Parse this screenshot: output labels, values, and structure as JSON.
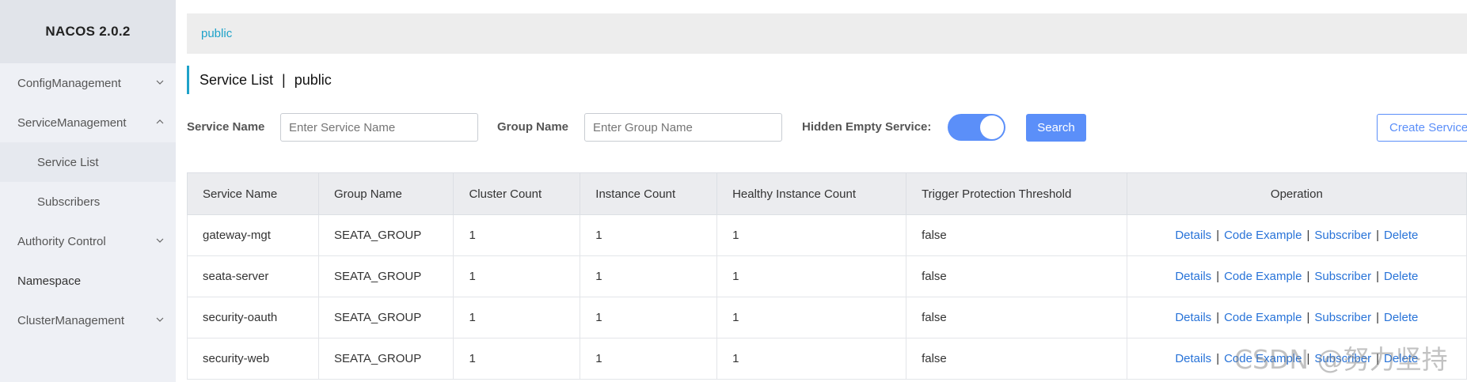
{
  "brand": {
    "title": "NACOS 2.0.2"
  },
  "sidebar": {
    "items": [
      {
        "label": "ConfigManagement"
      },
      {
        "label": "ServiceManagement"
      },
      {
        "label": "Service List"
      },
      {
        "label": "Subscribers"
      },
      {
        "label": "Authority Control"
      },
      {
        "label": "Namespace"
      },
      {
        "label": "ClusterManagement"
      }
    ]
  },
  "breadcrumb": {
    "namespace": "public"
  },
  "page": {
    "title": "Service List",
    "separator": "|",
    "namespace": "public"
  },
  "filters": {
    "service_name_label": "Service Name",
    "service_name_placeholder": "Enter Service Name",
    "group_name_label": "Group Name",
    "group_name_placeholder": "Enter Group Name",
    "hidden_empty_label": "Hidden Empty Service:",
    "hidden_empty_enabled": true,
    "search_label": "Search",
    "create_label": "Create Service"
  },
  "table": {
    "columns": [
      "Service Name",
      "Group Name",
      "Cluster Count",
      "Instance Count",
      "Healthy Instance Count",
      "Trigger Protection Threshold",
      "Operation"
    ],
    "rows": [
      {
        "service": "gateway-mgt",
        "group": "SEATA_GROUP",
        "clusters": "1",
        "instances": "1",
        "healthy": "1",
        "threshold": "false"
      },
      {
        "service": "seata-server",
        "group": "SEATA_GROUP",
        "clusters": "1",
        "instances": "1",
        "healthy": "1",
        "threshold": "false"
      },
      {
        "service": "security-oauth",
        "group": "SEATA_GROUP",
        "clusters": "1",
        "instances": "1",
        "healthy": "1",
        "threshold": "false"
      },
      {
        "service": "security-web",
        "group": "SEATA_GROUP",
        "clusters": "1",
        "instances": "1",
        "healthy": "1",
        "threshold": "false"
      }
    ],
    "operations": {
      "details": "Details",
      "code_example": "Code Example",
      "subscriber": "Subscriber",
      "delete": "Delete",
      "separator": "|"
    }
  },
  "watermark": "CSDN @努力坚持"
}
